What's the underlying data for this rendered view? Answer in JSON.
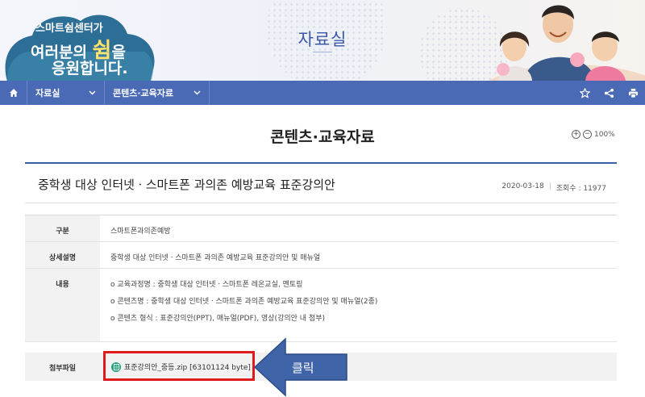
{
  "banner": {
    "slogan_line1": "스마트쉼센터가",
    "slogan_line2_pre": "여러분의 ",
    "slogan_line2_big": "쉼",
    "slogan_line2_post": "을",
    "slogan_line3": "응원합니다.",
    "title": "자료실"
  },
  "nav": {
    "menu1": "자료실",
    "menu2": "콘텐츠·교육자료"
  },
  "page": {
    "title": "콘텐츠·교육자료",
    "zoom_level": "100%"
  },
  "post": {
    "title": "중학생 대상 인터넷ㆍ스마트폰 과의존 예방교육 표준강의안",
    "date": "2020-03-18",
    "views": "조회수 : 11977"
  },
  "table": {
    "category_label": "구분",
    "category_value": "스마트폰과의존예방",
    "desc_label": "상세설명",
    "desc_value": "중학생 대상 인터넷ㆍ스마트폰 과의존 예방교육 표준강의안 및 매뉴얼",
    "content_label": "내용",
    "content_lines": [
      "o 교육과정명 : 중학생 대상 인터넷ㆍ스마트폰 레온교실, 멘토링",
      "o 콘텐츠명 : 중학생 대상 인터넷ㆍ스마트폰 과의존 예방교육 표준강의안 및 매뉴얼(2종)",
      "o 콘텐츠 형식 : 표준강의안(PPT), 매뉴얼(PDF), 영상(강의안 내 첨부)"
    ],
    "attach_label": "첨부파일",
    "attach_file": "표준강의안_중등.zip [63101124 byte]"
  },
  "annotation": {
    "callout_text": "클릭"
  },
  "colors": {
    "nav_bg": "#4a6ab6",
    "accent": "#3e5ba8",
    "highlight_box": "#e11b1b",
    "callout_fill": "#3f64a8"
  }
}
